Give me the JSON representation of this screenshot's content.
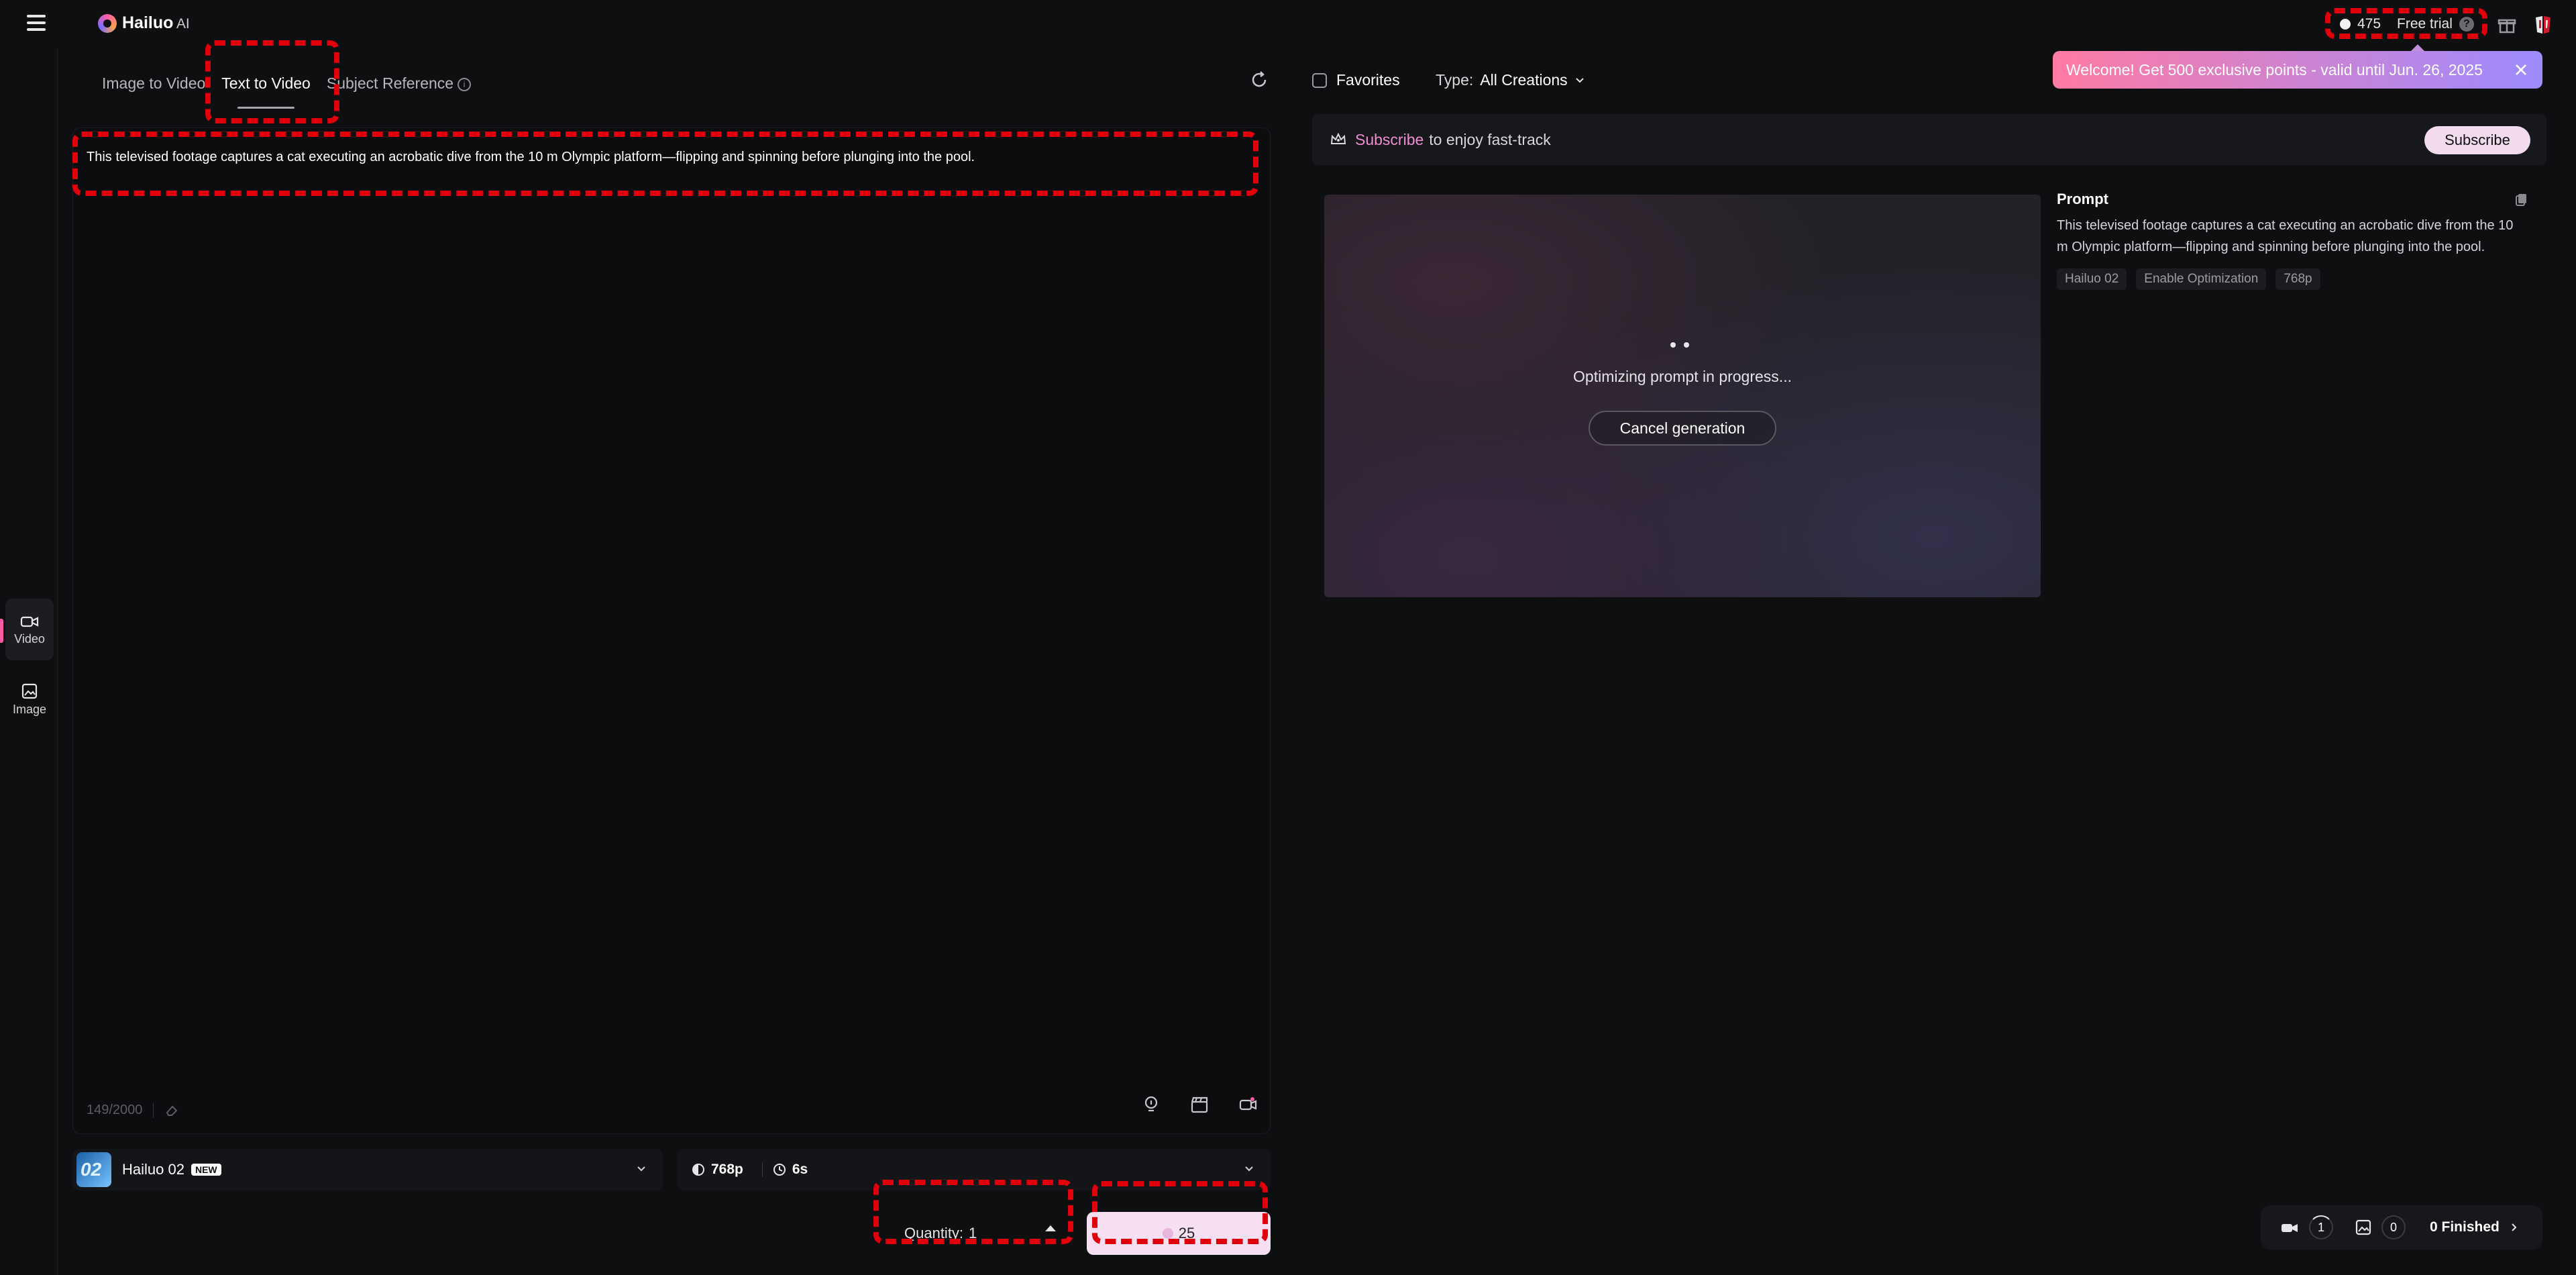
{
  "app": {
    "brand": "Hailuo",
    "brand_suffix": " AI",
    "points": "475",
    "plan": "Free trial",
    "help": "?"
  },
  "leftnav": {
    "items": [
      {
        "label": "Video"
      },
      {
        "label": "Image"
      }
    ]
  },
  "tabs": [
    {
      "label": "Image to Video"
    },
    {
      "label": "Text to Video"
    },
    {
      "label": "Subject Reference"
    }
  ],
  "editor": {
    "prompt": "This televised footage captures a cat executing an acrobatic dive from the 10 m Olympic platform—flipping and spinning before plunging into the pool.",
    "counter": "149/2000"
  },
  "model": {
    "thumb": "02",
    "name": "Hailuo 02",
    "badge": "NEW"
  },
  "settings": {
    "resolution": "768p",
    "duration": "6s"
  },
  "quantity": {
    "label": "Quantity:",
    "value": "1"
  },
  "generate": {
    "cost": "25"
  },
  "right": {
    "favorites": "Favorites",
    "type_label": "Type:",
    "type_value": "All Creations",
    "toast": "Welcome! Get 500 exclusive points - valid until Jun. 26, 2025",
    "subscribe_hl": "Subscribe",
    "subscribe_rest": "to enjoy fast-track",
    "subscribe_btn": "Subscribe"
  },
  "generation": {
    "status": "Optimizing prompt in progress...",
    "cancel": "Cancel generation",
    "prompt_title": "Prompt",
    "prompt": "This televised footage captures a cat executing an acrobatic dive from the 10 m Olympic platform—flipping and spinning before plunging into the pool.",
    "tags": [
      "Hailuo 02",
      "Enable Optimization",
      "768p"
    ]
  },
  "queue": {
    "video_count": "1",
    "image_count": "0",
    "finished": "0 Finished"
  },
  "colors": {
    "accent": "#ff5aa5",
    "annotation": "#e0000b",
    "generate_bg": "#f6dff0"
  }
}
